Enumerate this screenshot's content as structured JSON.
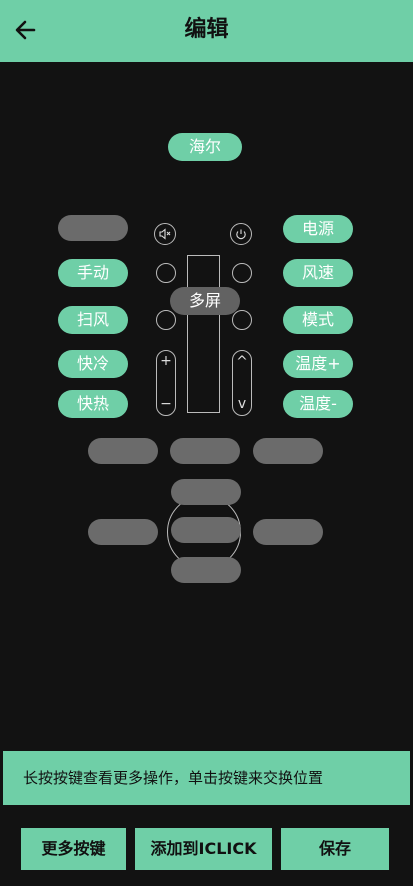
{
  "header": {
    "title": "编辑",
    "back_icon": "arrow-left-icon"
  },
  "brand": {
    "label": "海尔"
  },
  "remote": {
    "left": {
      "manual": "手动",
      "sweep": "扫风",
      "cool": "快冷",
      "heat": "快热"
    },
    "right": {
      "power": "电源",
      "fan_speed": "风速",
      "mode": "模式",
      "temp_up": "温度+",
      "temp_down": "温度-"
    },
    "center": {
      "multi_screen": "多屏"
    },
    "icons": {
      "mute": "mute-icon",
      "power": "power-icon"
    },
    "vol_plus": "+",
    "vol_minus": "−",
    "ch_up": "^",
    "ch_down": "v"
  },
  "tip": {
    "text": "长按按键查看更多操作，单击按键来交换位置"
  },
  "footer": {
    "more_keys": "更多按键",
    "add_iclick": "添加到ICLICK",
    "save": "保存"
  },
  "colors": {
    "accent": "#6fcfa7",
    "background": "#121212",
    "placeholder": "#6b6b6b"
  }
}
